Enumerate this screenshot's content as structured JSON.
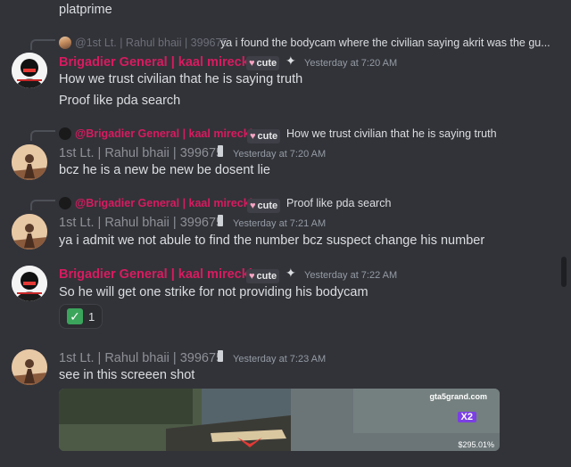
{
  "top_line": "platprime",
  "messages": [
    {
      "reply": {
        "name": "@1st Lt. | Rahul bhaii | 399675",
        "text": "ya i found the bodycam where the civilian saying akrit was the gu..."
      },
      "author": "Brigadier General | kaal mirecki",
      "tag": "cute",
      "time": "Yesterday at 7:20 AM",
      "lines": [
        "How we trust civilian that he is saying truth",
        "Proof like pda search"
      ]
    },
    {
      "reply": {
        "name": "@Brigadier General | kaal mirecki",
        "tag": "cute",
        "text": "How we trust civilian that he is saying truth"
      },
      "author": "1st Lt. | Rahul bhaii | 399675",
      "time": "Yesterday at 7:20 AM",
      "lines": [
        "bcz he is a new be new be dosent lie"
      ]
    },
    {
      "reply": {
        "name": "@Brigadier General | kaal mirecki",
        "tag": "cute",
        "text": "Proof like pda search"
      },
      "author": "1st Lt. | Rahul bhaii | 399675",
      "time": "Yesterday at 7:21 AM",
      "lines": [
        "ya i admit we not abule to find the number bcz suspect change his number"
      ]
    },
    {
      "author": "Brigadier General | kaal mirecki",
      "tag": "cute",
      "time": "Yesterday at 7:22 AM",
      "lines": [
        "So he will get one strike for not providing his bodycam"
      ],
      "reaction": {
        "emoji": "✅",
        "count": "1"
      }
    },
    {
      "author": "1st Lt. | Rahul bhaii | 399675",
      "time": "Yesterday at 7:23 AM",
      "lines": [
        "see in this screeen shot"
      ],
      "attachment": {
        "site": "gta5grand.com",
        "badge": "X2",
        "money": "$295.01%"
      }
    }
  ],
  "colors": {
    "background": "#323339",
    "pink_role": "#d81b60",
    "gray_role": "#8e9097"
  },
  "icons": {
    "tag_heart": "heart-icon",
    "sparkle": "sparkle-icon",
    "phone_badge": "phone-icon",
    "reaction": "check-emoji"
  }
}
